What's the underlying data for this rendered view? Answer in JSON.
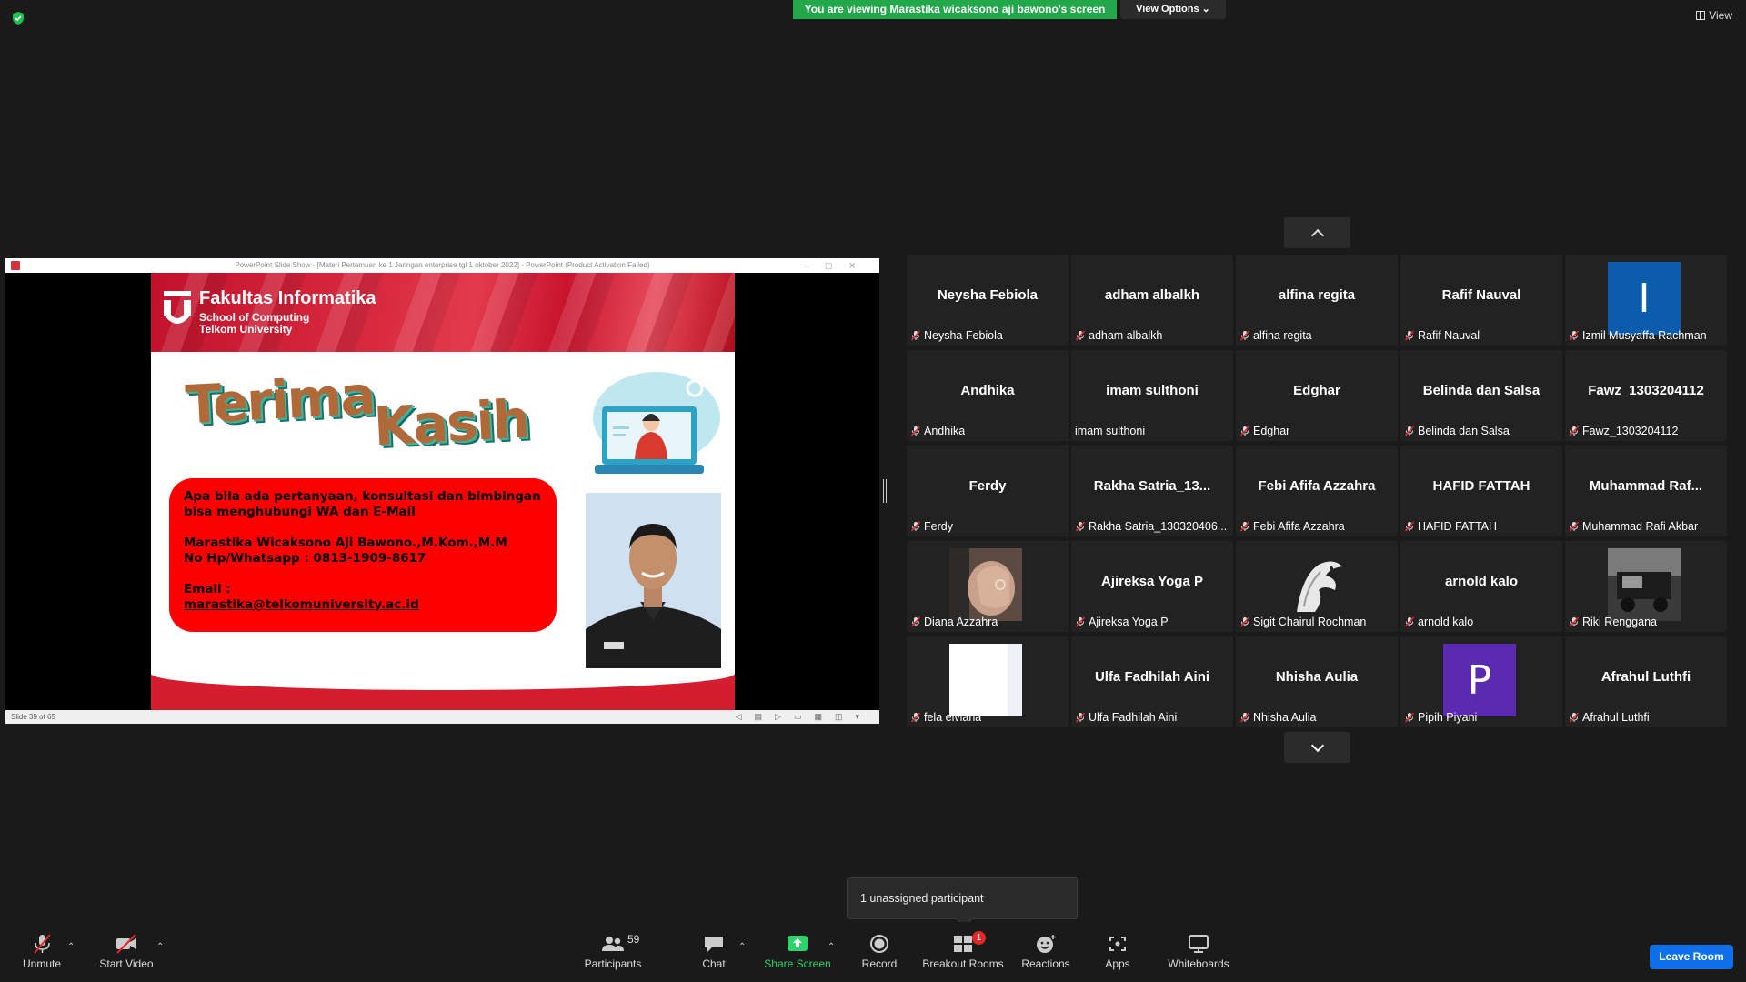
{
  "banner": {
    "viewing": "You are viewing Marastika wicaksono aji bawono's screen",
    "view_options": "View Options",
    "view": "View"
  },
  "share": {
    "window_title": "PowerPoint Slide Show - [Materi Pertemuan ke 1 Jaringan enterprise tgl 1 oktober 2022] - PowerPoint (Product Activation Failed)",
    "status": "Slide 39 of 65",
    "slide": {
      "faculty": "Fakultas Informatika",
      "school": "School of Computing",
      "university": "Telkom University",
      "heading_1": "Terima",
      "heading_2": "Kasih",
      "line_1": "Apa bila ada pertanyaan, konsultasi dan bimbingan bisa menghubungi WA dan E-Mail",
      "line_2": "Marastika Wicaksono Aji Bawono.,M.Kom.,M.M",
      "line_3": "No Hp/Whatsapp : 0813-1909-8617",
      "line_4": "Email :",
      "email": "marastika@telkomuniversity.ac.id"
    }
  },
  "gallery": [
    {
      "big": "Neysha Febiola",
      "label": "Neysha Febiola",
      "muted": true
    },
    {
      "big": "adham albalkh",
      "label": "adham albalkh",
      "muted": true
    },
    {
      "big": "alfina regita",
      "label": "alfina regita",
      "muted": true
    },
    {
      "big": "Rafif Nauval",
      "label": "Rafif Nauval",
      "muted": true
    },
    {
      "avatar": "I",
      "avatar_color": "#0b5cad",
      "label": "Izmil Musyaffa Rachman",
      "muted": true
    },
    {
      "big": "Andhika",
      "label": "Andhika",
      "muted": true
    },
    {
      "big": "imam sulthoni",
      "label": "imam sulthoni",
      "muted": false
    },
    {
      "big": "Edghar",
      "label": "Edghar",
      "muted": true
    },
    {
      "big": "Belinda dan Salsa",
      "label": "Belinda dan Salsa",
      "muted": true
    },
    {
      "big": "Fawz_1303204112",
      "label": "Fawz_1303204112",
      "muted": true
    },
    {
      "big": "Ferdy",
      "label": "Ferdy",
      "muted": true
    },
    {
      "big": "Rakha  Satria_13...",
      "label": "Rakha Satria_130320406...",
      "muted": true
    },
    {
      "big": "Febi Afifa Azzahra",
      "label": "Febi Afifa Azzahra",
      "muted": true
    },
    {
      "big": "HAFID FATTAH",
      "label": "HAFID FATTAH",
      "muted": true
    },
    {
      "big": "Muhammad  Raf...",
      "label": "Muhammad Rafi Akbar",
      "muted": true
    },
    {
      "photo": "hand",
      "label": "Diana Azzahra",
      "muted": true
    },
    {
      "big": "Ajireksa Yoga P",
      "label": "Ajireksa Yoga P",
      "muted": true
    },
    {
      "photo": "eagle",
      "label": "Sigit Chairul Rochman",
      "muted": true
    },
    {
      "big": "arnold kalo",
      "label": "arnold kalo",
      "muted": true
    },
    {
      "photo": "truck",
      "label": "Riki Renggana",
      "muted": true
    },
    {
      "photo": "white",
      "label": "fela elviana",
      "muted": true
    },
    {
      "big": "Ulfa Fadhilah Aini",
      "label": "Ulfa Fadhilah Aini",
      "muted": true
    },
    {
      "big": "Nhisha Aulia",
      "label": "Nhisha Aulia",
      "muted": true
    },
    {
      "avatar": "P",
      "avatar_color": "#5a2bb0",
      "label": "Pipih Piyani",
      "muted": true
    },
    {
      "big": "Afrahul Luthfi",
      "label": "Afrahul Luthfi",
      "muted": true
    }
  ],
  "toast": "1 unassigned participant",
  "toolbar": {
    "unmute": "Unmute",
    "start_video": "Start Video",
    "participants": "Participants",
    "participants_count": "59",
    "chat": "Chat",
    "share_screen": "Share Screen",
    "record": "Record",
    "breakout_rooms": "Breakout Rooms",
    "breakout_badge": "1",
    "reactions": "Reactions",
    "apps": "Apps",
    "whiteboards": "Whiteboards",
    "leave_room": "Leave Room"
  },
  "colors": {
    "share_green": "#2fd36b",
    "leave_blue": "#0e71eb",
    "banner_green": "#22a84a",
    "slide_red": "#ff0000"
  }
}
